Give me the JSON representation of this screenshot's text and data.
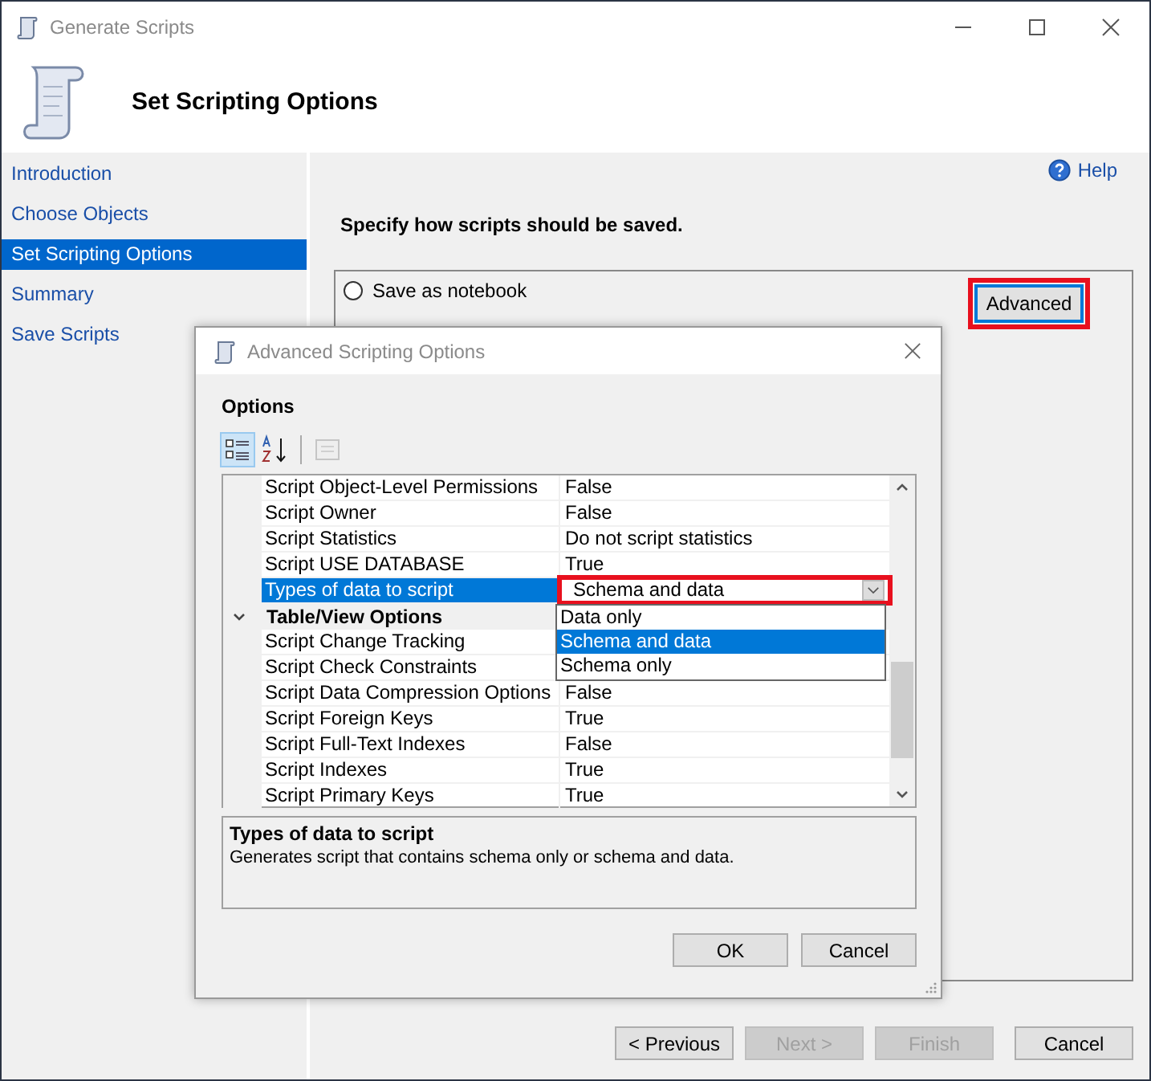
{
  "window": {
    "title": "Generate Scripts",
    "header": "Set Scripting Options"
  },
  "sidebar": {
    "items": [
      {
        "label": "Introduction",
        "selected": false
      },
      {
        "label": "Choose Objects",
        "selected": false
      },
      {
        "label": "Set Scripting Options",
        "selected": true
      },
      {
        "label": "Summary",
        "selected": false
      },
      {
        "label": "Save Scripts",
        "selected": false
      }
    ]
  },
  "help": "Help",
  "instruction": "Specify how scripts should be saved.",
  "save_options": {
    "radio": {
      "label": "Save as notebook",
      "selected": false
    },
    "advanced_button": {
      "label": "Advanced",
      "highlighted": true
    }
  },
  "dialog": {
    "title": "Advanced Scripting Options",
    "section": "Options",
    "toolbar": [
      {
        "kind": "categorized",
        "selected": true
      },
      {
        "kind": "alphabetical",
        "selected": false
      },
      {
        "kind": "pages",
        "disabled": true
      }
    ],
    "rows": [
      {
        "kind": "property",
        "name": "Script Object-Level Permissions",
        "value": "False",
        "selected": false
      },
      {
        "kind": "property",
        "name": "Script Owner",
        "value": "False",
        "selected": false
      },
      {
        "kind": "property",
        "name": "Script Statistics",
        "value": "Do not script statistics",
        "selected": false
      },
      {
        "kind": "property",
        "name": "Script USE DATABASE",
        "value": "True",
        "selected": false
      },
      {
        "kind": "dropdown",
        "name": "Types of data to script",
        "value": "Schema and data",
        "selected": true,
        "highlighted": true,
        "expanded": true,
        "options": [
          {
            "label": "Data only",
            "selected": false
          },
          {
            "label": "Schema and data",
            "selected": true
          },
          {
            "label": "Schema only",
            "selected": false
          }
        ]
      },
      {
        "kind": "category",
        "name": "Table/View Options",
        "expanded": true
      },
      {
        "kind": "property",
        "name": "Script Change Tracking",
        "selected": false
      },
      {
        "kind": "property",
        "name": "Script Check Constraints",
        "selected": false
      },
      {
        "kind": "property",
        "name": "Script Data Compression Options",
        "value": "False",
        "selected": false
      },
      {
        "kind": "property",
        "name": "Script Foreign Keys",
        "value": "True",
        "selected": false
      },
      {
        "kind": "property",
        "name": "Script Full-Text Indexes",
        "value": "False",
        "selected": false
      },
      {
        "kind": "property",
        "name": "Script Indexes",
        "value": "True",
        "selected": false
      },
      {
        "kind": "property",
        "name": "Script Primary Keys",
        "value": "True",
        "selected": false
      }
    ],
    "description": {
      "title": "Types of data to script",
      "text": "Generates script that contains schema only or schema and data."
    },
    "buttons": [
      {
        "label": "OK"
      },
      {
        "label": "Cancel"
      }
    ]
  },
  "buttons": [
    {
      "label": "< Previous",
      "disabled": false
    },
    {
      "label": "Next >",
      "disabled": true
    },
    {
      "label": "Finish",
      "disabled": true
    },
    {
      "label": "Cancel",
      "disabled": false
    }
  ]
}
